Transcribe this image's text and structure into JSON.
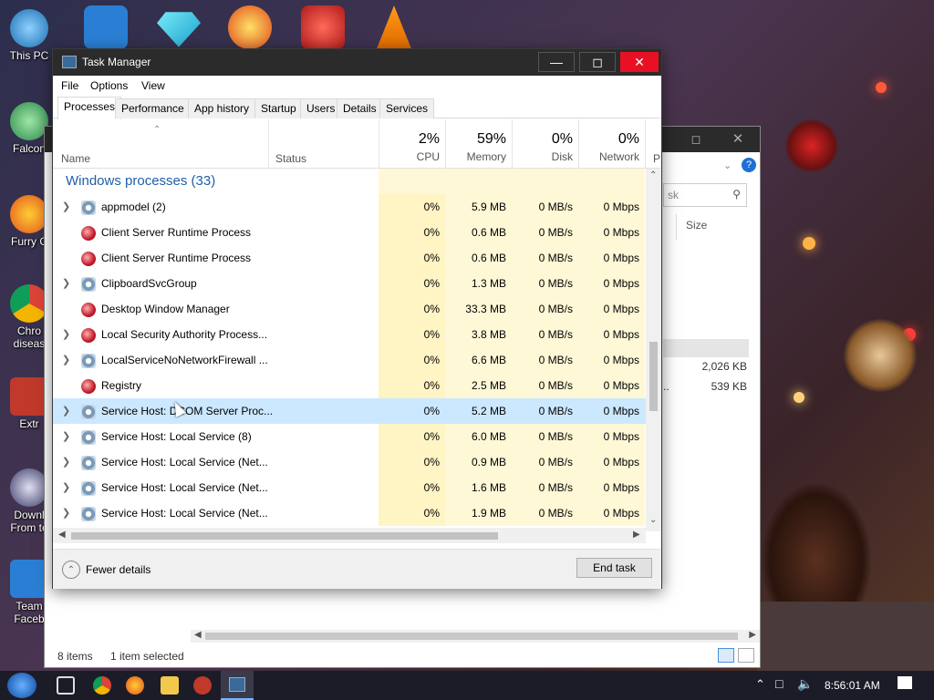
{
  "desktop": {
    "icons": [
      {
        "label": "This PC",
        "icon": "this-pc-icon"
      },
      {
        "label": "Falcon",
        "icon": "falcon-icon"
      },
      {
        "label": "Furry C",
        "icon": "firefox-icon"
      },
      {
        "label": "Chro diseas",
        "icon": "chrome-icon"
      },
      {
        "label": "Extr",
        "icon": "gift-icon"
      },
      {
        "label": "Downl From te",
        "icon": "download-icon"
      },
      {
        "label": "Team Faceb",
        "icon": "gear-icon"
      }
    ]
  },
  "explorer": {
    "search_placeholder": "sk",
    "size_header": "Size",
    "sizes": [
      "2,026 KB",
      "539 KB"
    ],
    "row_prefix": "..",
    "status_items": "8 items",
    "status_selected": "1 item selected"
  },
  "task_manager": {
    "title": "Task Manager",
    "menu": [
      "File",
      "Options",
      "View"
    ],
    "tabs": [
      "Processes",
      "Performance",
      "App history",
      "Startup",
      "Users",
      "Details",
      "Services"
    ],
    "active_tab": "Processes",
    "columns": {
      "name": "Name",
      "status": "Status",
      "cpu": {
        "pct": "2%",
        "label": "CPU"
      },
      "memory": {
        "pct": "59%",
        "label": "Memory"
      },
      "disk": {
        "pct": "0%",
        "label": "Disk"
      },
      "network": {
        "pct": "0%",
        "label": "Network"
      },
      "power": "P"
    },
    "group_title": "Windows processes (33)",
    "rows": [
      {
        "name": "appmodel (2)",
        "expandable": true,
        "icon": "gear-icon",
        "cpu": "0%",
        "memory": "5.9 MB",
        "disk": "0 MB/s",
        "network": "0 Mbps"
      },
      {
        "name": "Client Server Runtime Process",
        "expandable": false,
        "icon": "system-process-icon",
        "cpu": "0%",
        "memory": "0.6 MB",
        "disk": "0 MB/s",
        "network": "0 Mbps"
      },
      {
        "name": "Client Server Runtime Process",
        "expandable": false,
        "icon": "system-process-icon",
        "cpu": "0%",
        "memory": "0.6 MB",
        "disk": "0 MB/s",
        "network": "0 Mbps"
      },
      {
        "name": "ClipboardSvcGroup",
        "expandable": true,
        "icon": "gear-icon",
        "cpu": "0%",
        "memory": "1.3 MB",
        "disk": "0 MB/s",
        "network": "0 Mbps"
      },
      {
        "name": "Desktop Window Manager",
        "expandable": false,
        "icon": "system-process-icon",
        "cpu": "0%",
        "memory": "33.3 MB",
        "disk": "0 MB/s",
        "network": "0 Mbps"
      },
      {
        "name": "Local Security Authority Process...",
        "expandable": true,
        "icon": "system-process-icon",
        "cpu": "0%",
        "memory": "3.8 MB",
        "disk": "0 MB/s",
        "network": "0 Mbps"
      },
      {
        "name": "LocalServiceNoNetworkFirewall ...",
        "expandable": true,
        "icon": "gear-icon",
        "cpu": "0%",
        "memory": "6.6 MB",
        "disk": "0 MB/s",
        "network": "0 Mbps"
      },
      {
        "name": "Registry",
        "expandable": false,
        "icon": "system-process-icon",
        "cpu": "0%",
        "memory": "2.5 MB",
        "disk": "0 MB/s",
        "network": "0 Mbps"
      },
      {
        "name": "Service Host: DCOM Server Proc...",
        "expandable": true,
        "icon": "gear-icon",
        "cpu": "0%",
        "memory": "5.2 MB",
        "disk": "0 MB/s",
        "network": "0 Mbps",
        "selected": true
      },
      {
        "name": "Service Host: Local Service (8)",
        "expandable": true,
        "icon": "gear-icon",
        "cpu": "0%",
        "memory": "6.0 MB",
        "disk": "0 MB/s",
        "network": "0 Mbps"
      },
      {
        "name": "Service Host: Local Service (Net...",
        "expandable": true,
        "icon": "gear-icon",
        "cpu": "0%",
        "memory": "0.9 MB",
        "disk": "0 MB/s",
        "network": "0 Mbps"
      },
      {
        "name": "Service Host: Local Service (Net...",
        "expandable": true,
        "icon": "gear-icon",
        "cpu": "0%",
        "memory": "1.6 MB",
        "disk": "0 MB/s",
        "network": "0 Mbps"
      },
      {
        "name": "Service Host: Local Service (Net...",
        "expandable": true,
        "icon": "gear-icon",
        "cpu": "0%",
        "memory": "1.9 MB",
        "disk": "0 MB/s",
        "network": "0 Mbps"
      }
    ],
    "fewer_details": "Fewer details",
    "end_task": "End task"
  },
  "taskbar": {
    "clock": "8:56:01 AM"
  },
  "colors": {
    "accent_blue": "#1f5fa8",
    "heat_light": "#fff8d6",
    "selection": "#cce8ff",
    "title_bar": "#2b2b2b",
    "close_red": "#e81123"
  }
}
